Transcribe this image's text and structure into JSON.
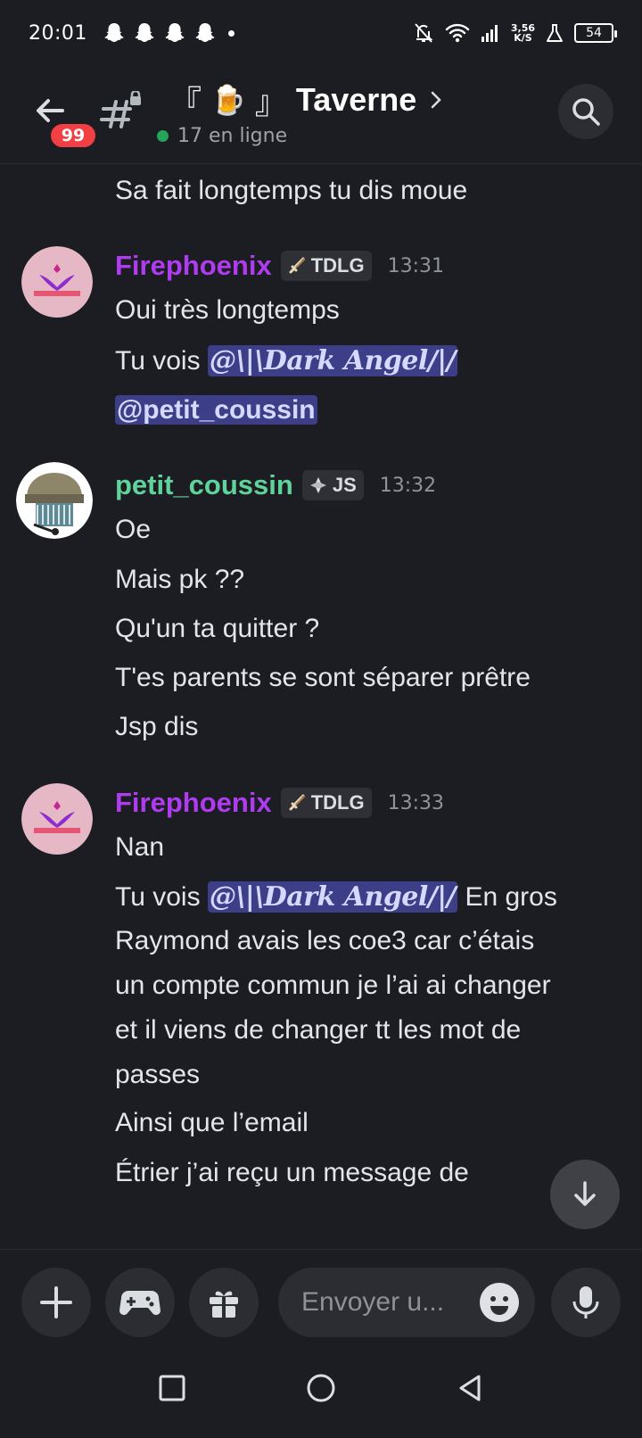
{
  "status_bar": {
    "time": "20:01",
    "speed_value": "3,56",
    "speed_unit": "K/S",
    "battery": "54"
  },
  "header": {
    "unread_badge": "99",
    "title_prefix_open": "『",
    "title_emoji": "🍺",
    "title_prefix_close": "』",
    "channel_name": "Taverne",
    "online_count": "17 en ligne"
  },
  "messages": {
    "prev_line": "Sa fait longtemps tu dis moue",
    "group1": {
      "author": "Firephoenix",
      "role_icon": "sword-icon",
      "role": "TDLG",
      "time": "13:31",
      "line1": "Oui très longtemps",
      "line2_prefix": "Tu vois ",
      "mention_dark_angel": "@\\|\\Dark Angel/|/",
      "mention_petit": "@petit_coussin"
    },
    "group2": {
      "author": "petit_coussin",
      "role_icon": "diamond-icon",
      "role": "JS",
      "time": "13:32",
      "lines": [
        "Oe",
        "Mais pk ??",
        "Qu'un ta quitter ?",
        "T'es parents se sont séparer prêtre",
        "Jsp dis"
      ]
    },
    "group3": {
      "author": "Firephoenix",
      "role_icon": "sword-icon",
      "role": "TDLG",
      "time": "13:33",
      "line1": "Nan",
      "line2_prefix": "Tu vois ",
      "mention_dark_angel": "@\\|\\Dark Angel/|/",
      "line2_suffix": " En gros",
      "lines": [
        "Raymond avais les coe3 car c’étais",
        "un compte commun je l’ai ai changer",
        "et il viens de changer tt les mot de",
        "passes",
        "Ainsi que l’email",
        "Étrier j’ai reçu un message de"
      ]
    }
  },
  "composer": {
    "placeholder": "Envoyer u..."
  }
}
